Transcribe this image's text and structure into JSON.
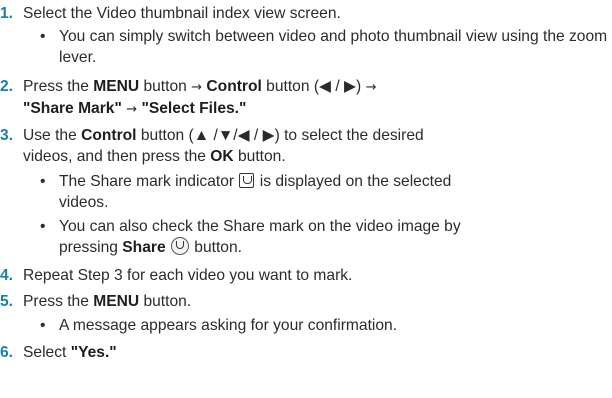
{
  "steps": [
    {
      "number": "1.",
      "text": "Select the Video thumbnail index view screen.",
      "bullets": [
        "You can simply switch between video and photo thumbnail view using the zoom lever."
      ]
    },
    {
      "number": "2.",
      "parts": {
        "t1": "Press the ",
        "menu": "MENU",
        "t2": " button ",
        "arrow1": "→",
        "control": "Control",
        "t3": " button (◀ / ▶) ",
        "arrow2": "→",
        "share_mark": "\"Share Mark\"",
        "arrow3": "→",
        "select_files": "\"Select Files.\""
      }
    },
    {
      "number": "3.",
      "parts": {
        "t1": "Use the ",
        "control": "Control",
        "t2": " button (▲ /▼/◀ / ▶) to select the desired",
        "t3": "videos, and then press the ",
        "ok": "OK",
        "t4": " button."
      },
      "bullets": [
        {
          "a": "The Share mark indicator",
          "b": " is displayed on the selected",
          "c": "videos."
        },
        {
          "a": "You can also check the Share mark on the video image by",
          "b": "pressing ",
          "share": "Share",
          "c": " button."
        }
      ]
    },
    {
      "number": "4.",
      "text": "Repeat Step 3 for each video you want to mark."
    },
    {
      "number": "5.",
      "parts": {
        "t1": "Press the ",
        "menu": "MENU",
        "t2": " button."
      },
      "bullets": [
        "A message appears asking for your confirmation."
      ]
    },
    {
      "number": "6.",
      "parts": {
        "t1": "Select ",
        "yes": "\"Yes.\""
      }
    }
  ],
  "icons": [
    "share-mark-icon",
    "share-button-icon"
  ],
  "colors": {
    "step_number": "#1a7fa8",
    "text": "#2b2b2b"
  },
  "bullet_char": "•"
}
